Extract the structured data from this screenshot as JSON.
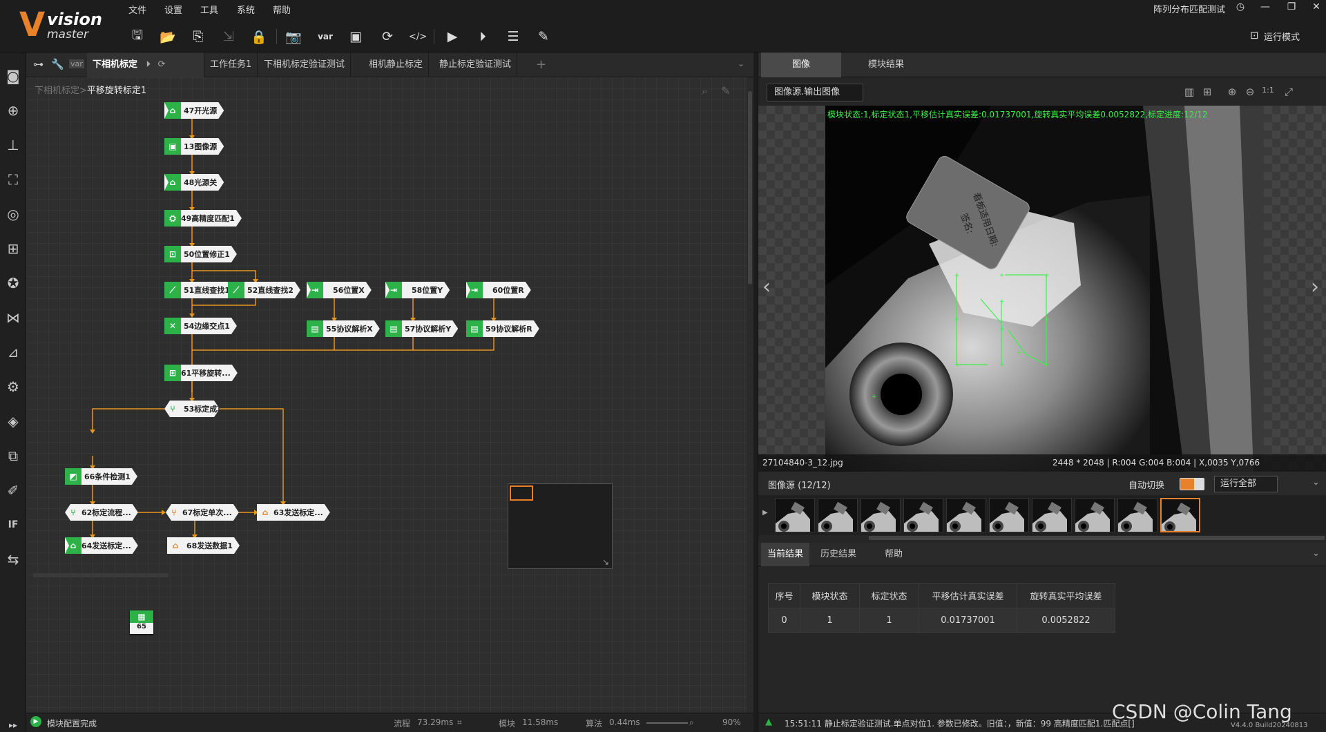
{
  "app": {
    "logo_big": "V",
    "logo_line1": "vision",
    "logo_line2": "master",
    "window_title": "阵列分布匹配测试",
    "run_mode": "运行模式"
  },
  "menu": [
    "文件",
    "设置",
    "工具",
    "系统",
    "帮助"
  ],
  "toolbar_icons": [
    "save-icon",
    "open-folder-icon",
    "save-as-icon",
    "import-icon",
    "lock-icon",
    "camera-icon",
    "variable-icon",
    "clipboard-icon",
    "loop-icon",
    "code-icon",
    "run-icon",
    "run-once-icon",
    "list-icon",
    "report-icon"
  ],
  "tabs": {
    "main_label": "下相机标定",
    "items": [
      "工作任务1",
      "下相机标定验证测试",
      "相机静止标定",
      "静止标定验证测试"
    ],
    "add": "+"
  },
  "breadcrumb": {
    "parent": "下相机标定",
    "sep": ">",
    "current": "平移旋转标定1"
  },
  "nodes": {
    "n47": "47开光源",
    "n13": "13图像源",
    "n48": "48光源关",
    "n49": "49高精度匹配1",
    "n50": "50位置修正1",
    "n51": "51直线查找1",
    "n52": "52直线查找2",
    "n54": "54边缘交点1",
    "n56": "56位置X",
    "n58": "58位置Y",
    "n60": "60位置R",
    "n55": "55协议解析X",
    "n57": "57协议解析Y",
    "n59": "59协议解析R",
    "n61": "61平移旋转...",
    "n53": "53标定成功",
    "n65": "65",
    "n66": "66条件检测1",
    "n62": "62标定流程...",
    "n67": "67标定单次...",
    "n63": "63发送标定...",
    "n64": "64发送标定...",
    "n68": "68发送数据1"
  },
  "status": {
    "left": "模块配置完成",
    "flow_label": "流程",
    "flow_time": "73.29ms",
    "module_label": "模块",
    "module_time": "11.58ms",
    "algo_label": "算法",
    "algo_time": "0.44ms",
    "zoom": "90%"
  },
  "right": {
    "tab_image": "图像",
    "tab_results": "模块结果",
    "image_source_select": "图像源.输出图像",
    "overlay": "模块状态:1,标定状态1,平移估计真实误差:0.01737001,旋转真实平均误差0.0052822,标定进度:12/12",
    "label_text1": "看板适用日期:",
    "label_text2": "签名:",
    "filename": "27104840-3_12.jpg",
    "pixel_info": "2448 * 2048  |  R:004  G:004  B:004  |  X,0035  Y,0766",
    "source_count": "图像源 (12/12)",
    "auto_switch": "自动切换",
    "run_all": "运行全部",
    "result_tabs": [
      "当前结果",
      "历史结果",
      "帮助"
    ],
    "table_headers": [
      "序号",
      "模块状态",
      "标定状态",
      "平移估计真实误差",
      "旋转真实平均误差"
    ],
    "table_rows": [
      [
        "0",
        "1",
        "1",
        "0.01737001",
        "0.0052822"
      ]
    ],
    "log": "15:51:11  静止标定验证测试.单点对位1. 参数已修改。旧值：，新值：99 高精度匹配1.匹配点[]",
    "version": "V4.4.0 Build20240813"
  },
  "watermark": "CSDN @Colin Tang",
  "colors": {
    "accent": "#e7822a",
    "node_green": "#2db24a",
    "overlay_green": "#3cf04a"
  }
}
